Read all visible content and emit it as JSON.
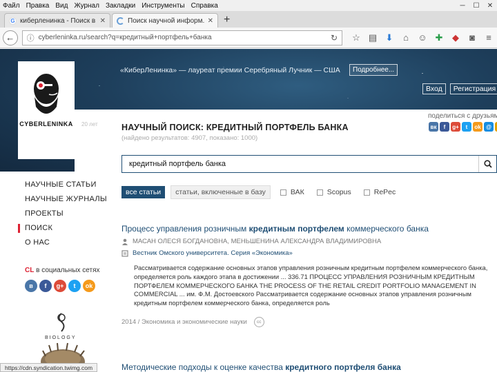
{
  "browser": {
    "menu": [
      "Файл",
      "Правка",
      "Вид",
      "Журнал",
      "Закладки",
      "Инструменты",
      "Справка"
    ],
    "tabs": [
      {
        "title": "киберленинка - Поиск в ...",
        "favicon": "google-icon"
      },
      {
        "title": "Поиск научной информ...",
        "favicon": "loading-icon"
      }
    ],
    "url": "cyberleninka.ru/search?q=кредитный+портфель+банка",
    "status": "https://cdn.syndication.twimg.com"
  },
  "header": {
    "announcement": "«КиберЛенинка» — лауреат премии Серебряный Лучник — США",
    "more_label": "Подробнее...",
    "login_label": "Вход",
    "register_label": "Регистрация",
    "logo_text": "CYBERLENINKA"
  },
  "share": {
    "label": "поделиться с друзьями",
    "icons": [
      {
        "name": "vk-icon",
        "glyph": "вк",
        "color": "#4a76a8"
      },
      {
        "name": "facebook-icon",
        "glyph": "f",
        "color": "#3b5998"
      },
      {
        "name": "gplus-icon",
        "glyph": "g+",
        "color": "#dd4b39"
      },
      {
        "name": "twitter-icon",
        "glyph": "t",
        "color": "#1da1f2"
      },
      {
        "name": "odnoklassniki-icon",
        "glyph": "ok",
        "color": "#f59a1b"
      },
      {
        "name": "mailru-icon",
        "glyph": "@",
        "color": "#168de2"
      },
      {
        "name": "more-icon",
        "glyph": "+",
        "color": "#e8a200"
      }
    ]
  },
  "search": {
    "badge": "20 лет",
    "title": "НАУЧНЫЙ ПОИСК: КРЕДИТНЫЙ ПОРТФЕЛЬ БАНКА",
    "stats": "(найдено результатов: 4907, показано: 1000)",
    "query": "кредитный портфель банка"
  },
  "filters": {
    "all": "все статьи",
    "vak": "статьи, включенные в базу",
    "checks": [
      "ВАК",
      "Scopus",
      "RePec"
    ]
  },
  "nav": {
    "items": [
      "НАУЧНЫЕ СТАТЬИ",
      "НАУЧНЫЕ ЖУРНАЛЫ",
      "ПРОЕКТЫ",
      "ПОИСК",
      "О НАС"
    ],
    "social_label_prefix": "CL",
    "social_label": " в социальных сетях",
    "social": [
      {
        "name": "vk-icon",
        "glyph": "в",
        "color": "#4a76a8"
      },
      {
        "name": "facebook-icon",
        "glyph": "f",
        "color": "#3b5998"
      },
      {
        "name": "gplus-icon",
        "glyph": "g+",
        "color": "#dd4b39"
      },
      {
        "name": "twitter-icon",
        "glyph": "t",
        "color": "#1da1f2"
      },
      {
        "name": "odnoklassniki-icon",
        "glyph": "ok",
        "color": "#f59a1b"
      }
    ],
    "ad_text": "BIOLOGY"
  },
  "results": [
    {
      "title_pre": "Процесс управления розничным ",
      "title_bold": "кредитным портфелем",
      "title_post": " коммерческого банка",
      "authors": "МАСАН ОЛЕСЯ БОГДАНОВНА, МЕНЬШЕНИНА АЛЕКСАНДРА ВЛАДИМИРОВНА",
      "journal": "Вестник Омского университета. Серия «Экономика»",
      "abstract": "Рассматривается содержание основных этапов управления розничным кредитным портфелем коммерческого банка, определяется роль каждого этапа в достижении ... 336.71 ПРОЦЕСС УПРАВЛЕНИЯ РОЗНИЧНЫМ КРЕДИТНЫМ ПОРТФЕЛЕМ КОММЕРЧЕСКОГО БАНКА THE PROCESS OF THE RETAIL CREDIT PORTFOLIO MANAGEMENT IN COMMERCIAL ... им. Ф.М. Достоевского Рассматривается содержание основных этапов управления розничным кредитным портфелем коммерческого банка, определяется роль",
      "meta": "2014 / Экономика и экономические науки",
      "license": "cc"
    },
    {
      "title_pre": "Методические подходы к оценке качества ",
      "title_bold": "кредитного портфеля банка",
      "title_post": ""
    }
  ]
}
